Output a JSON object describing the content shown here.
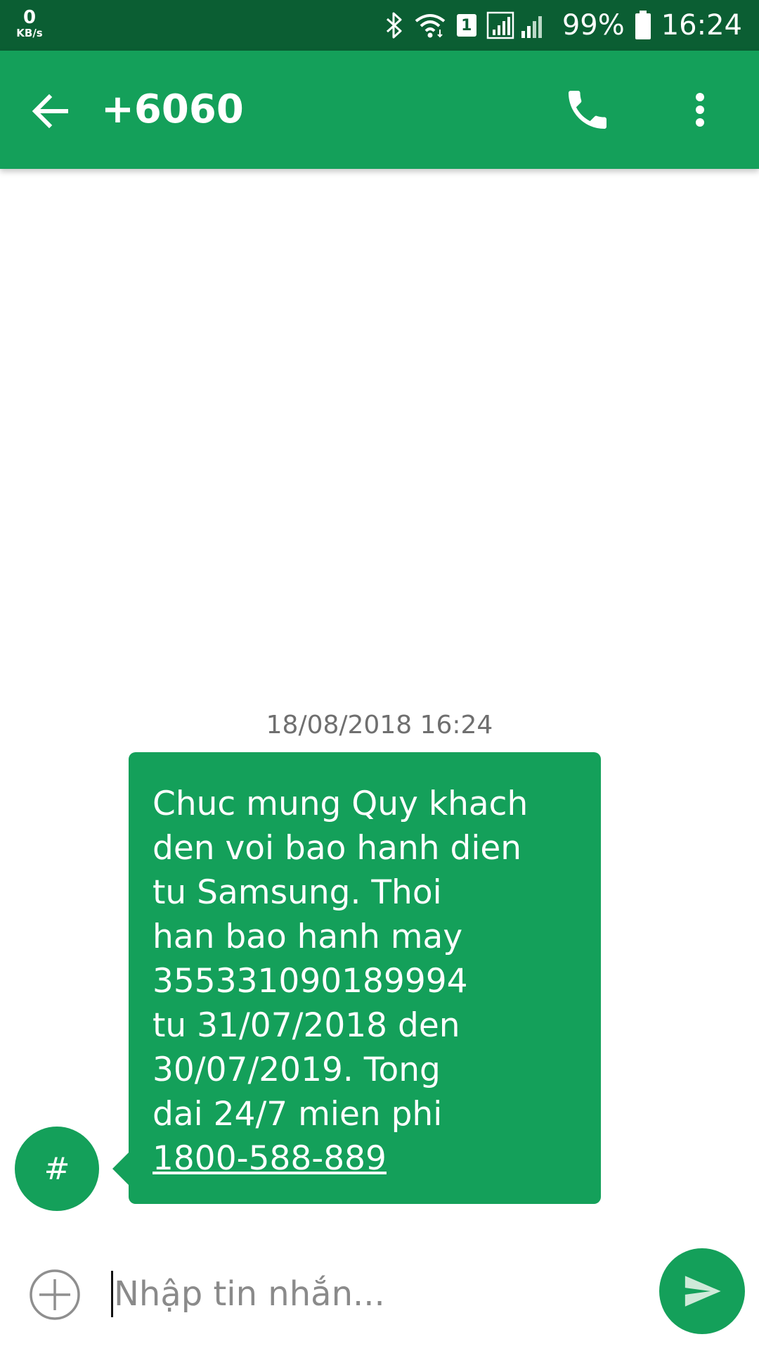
{
  "status_bar": {
    "speed_value": "0",
    "speed_unit": "KB/s",
    "sim_slot": "1",
    "battery_percent": "99%",
    "time": "16:24",
    "icons": [
      "bluetooth-icon",
      "wifi-icon",
      "signal-icon",
      "battery-icon"
    ]
  },
  "app_bar": {
    "title": "+6060",
    "icons": [
      "arrow-back-icon",
      "phone-icon",
      "more-vert-icon"
    ],
    "color": "#14a05a"
  },
  "conversation": {
    "timestamp": "18/08/2018 16:24",
    "avatar_label": "#",
    "message": {
      "lines": [
        "Chuc mung Quy khach",
        "den voi bao hanh dien",
        "tu Samsung. Thoi",
        "han bao hanh may",
        "355331090189994",
        "tu 31/07/2018 den",
        "30/07/2019. Tong",
        "dai 24/7 mien phi"
      ],
      "link": "1800-588-889"
    }
  },
  "composer": {
    "placeholder": "Nhập tin nhắn...",
    "value": "",
    "icons": [
      "add-circle-icon",
      "send-icon"
    ]
  },
  "colors": {
    "status_bar": "#0b5e33",
    "accent": "#14a05a",
    "timestamp_text": "#6f6f6f",
    "placeholder_text": "#8a8a8a"
  }
}
